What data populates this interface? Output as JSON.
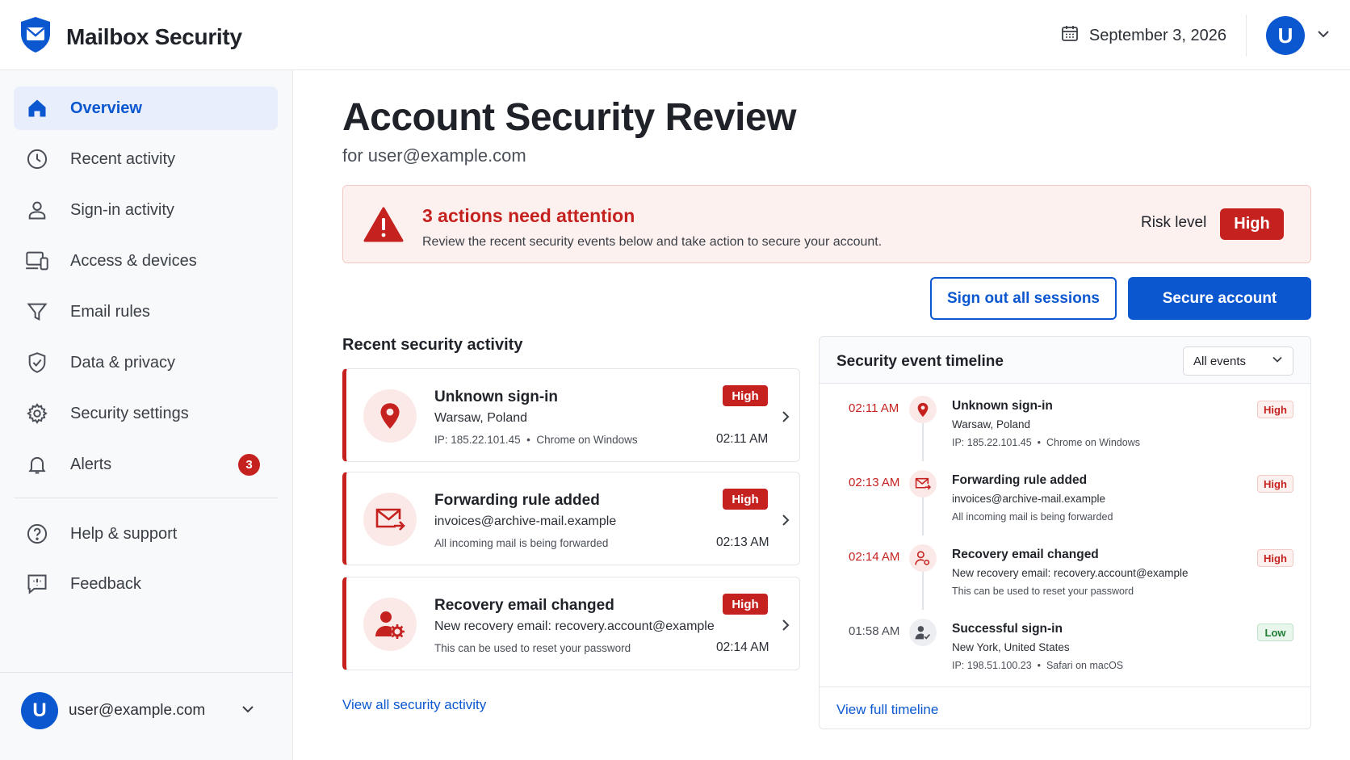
{
  "app": {
    "title": "Mailbox Security"
  },
  "header": {
    "date": "September 3, 2026",
    "avatar_initial": "U"
  },
  "sidebar": {
    "items": [
      {
        "label": "Overview",
        "icon": "home-icon",
        "active": true
      },
      {
        "label": "Recent activity",
        "icon": "clock-icon"
      },
      {
        "label": "Sign-in activity",
        "icon": "person-icon"
      },
      {
        "label": "Access & devices",
        "icon": "devices-icon"
      },
      {
        "label": "Email rules",
        "icon": "filter-icon"
      },
      {
        "label": "Data & privacy",
        "icon": "shield-check-icon"
      },
      {
        "label": "Security settings",
        "icon": "gear-icon"
      },
      {
        "label": "Alerts",
        "icon": "bell-icon",
        "badge": "3"
      },
      {
        "label": "Help & support",
        "icon": "help-icon"
      },
      {
        "label": "Feedback",
        "icon": "feedback-icon"
      }
    ],
    "user": {
      "initial": "U",
      "email": "user@example.com"
    }
  },
  "main": {
    "title": "Account Security Review",
    "subtitle": "for user@example.com",
    "alert": {
      "title": "3 actions need attention",
      "description": "Review the recent security events below and take action to secure your account.",
      "risk_label": "Risk level",
      "risk_value": "High"
    },
    "actions": {
      "sign_out": "Sign out all sessions",
      "secure": "Secure account"
    },
    "recent": {
      "title": "Recent security activity",
      "items": [
        {
          "title": "Unknown sign-in",
          "line1": "Warsaw, Poland",
          "line2": "IP: 185.22.101.45  •  Chrome on Windows",
          "severity": "High",
          "time": "02:11 AM",
          "icon": "location-pin-icon"
        },
        {
          "title": "Forwarding rule added",
          "line1": "invoices@archive-mail.example",
          "line2": "All incoming mail is being forwarded",
          "severity": "High",
          "time": "02:13 AM",
          "icon": "mail-forward-icon"
        },
        {
          "title": "Recovery email changed",
          "line1": "New recovery email: recovery.account@example",
          "line2": "This can be used to reset your password",
          "severity": "High",
          "time": "02:14 AM",
          "icon": "user-gear-icon"
        }
      ],
      "view_all": "View all security activity"
    },
    "timeline": {
      "title": "Security event timeline",
      "filter": "All events",
      "events": [
        {
          "time": "02:11 AM",
          "title": "Unknown sign-in",
          "line1": "Warsaw, Poland",
          "line2": "IP: 185.22.101.45  •  Chrome on Windows",
          "severity": "High",
          "icon": "location-pin-icon"
        },
        {
          "time": "02:13 AM",
          "title": "Forwarding rule added",
          "line1": "invoices@archive-mail.example",
          "line2": "All incoming mail is being forwarded",
          "severity": "High",
          "icon": "mail-forward-icon"
        },
        {
          "time": "02:14 AM",
          "title": "Recovery email changed",
          "line1": "New recovery email: recovery.account@example",
          "line2": "This can be used to reset your password",
          "severity": "High",
          "icon": "user-gear-icon"
        },
        {
          "time": "01:58 AM",
          "title": "Successful sign-in",
          "line1": "New York, United States",
          "line2": "IP: 198.51.100.23  •  Safari on macOS",
          "severity": "Low",
          "icon": "user-check-icon"
        }
      ],
      "view_full": "View full timeline"
    }
  },
  "colors": {
    "accent": "#0b57d0",
    "danger": "#c5221f",
    "success": "#1e7e34"
  }
}
